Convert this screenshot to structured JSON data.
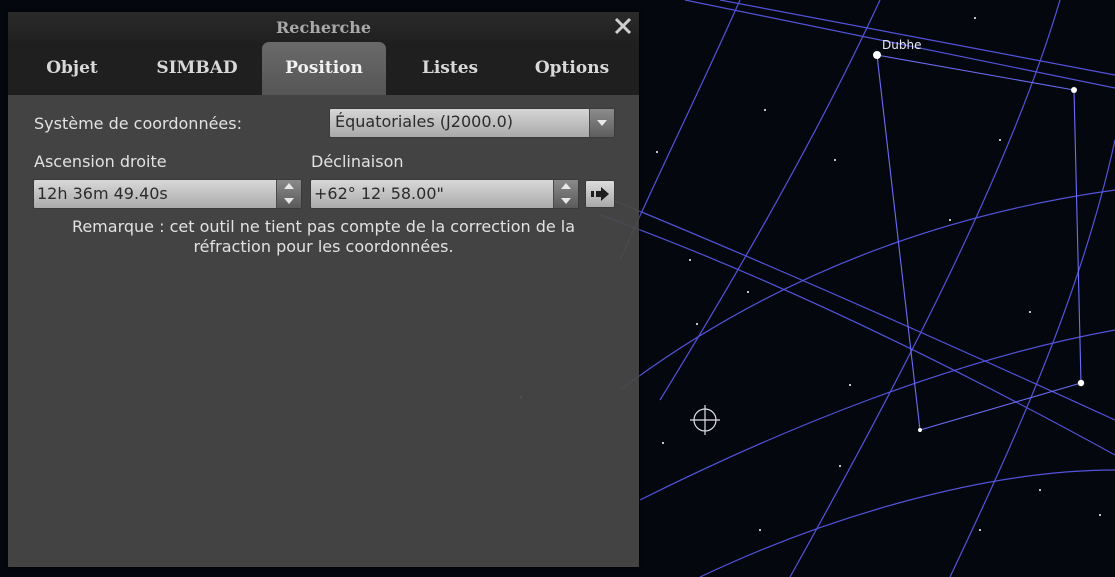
{
  "sky": {
    "star_labels": [
      {
        "name": "Dubhe"
      }
    ],
    "line_color": "#5b5cf0",
    "background_color": "#05070f"
  },
  "dialog": {
    "title": "Recherche",
    "close_icon": "close-icon",
    "tabs": [
      {
        "label": "Objet",
        "active": false
      },
      {
        "label": "SIMBAD",
        "active": false
      },
      {
        "label": "Position",
        "active": true
      },
      {
        "label": "Listes",
        "active": false
      },
      {
        "label": "Options",
        "active": false
      }
    ],
    "coordinate_system": {
      "label": "Système de coordonnées:",
      "value": "Équatoriales (J2000.0)"
    },
    "right_ascension": {
      "label": "Ascension droite",
      "value": "12h 36m 49.40s"
    },
    "declination": {
      "label": "Déclinaison",
      "value": "+62° 12' 58.00\""
    },
    "goto_icon": "arrow-right-icon",
    "note": "Remarque : cet outil ne tient pas compte de la correction de la réfraction pour les coordonnées."
  }
}
